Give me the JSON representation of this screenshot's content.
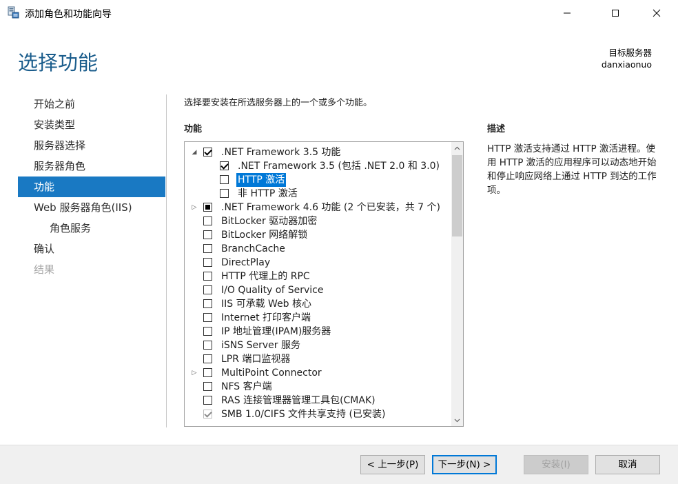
{
  "window": {
    "title": "添加角色和功能向导"
  },
  "header": {
    "page_title": "选择功能",
    "target_server_label": "目标服务器",
    "target_server_name": "danxiaonuo"
  },
  "nav": {
    "items": [
      {
        "label": "开始之前",
        "state": "normal"
      },
      {
        "label": "安装类型",
        "state": "normal"
      },
      {
        "label": "服务器选择",
        "state": "normal"
      },
      {
        "label": "服务器角色",
        "state": "normal"
      },
      {
        "label": "功能",
        "state": "active"
      },
      {
        "label": "Web 服务器角色(IIS)",
        "state": "normal"
      },
      {
        "label": "角色服务",
        "state": "sub"
      },
      {
        "label": "确认",
        "state": "normal"
      },
      {
        "label": "结果",
        "state": "disabled"
      }
    ]
  },
  "main": {
    "intro": "选择要安装在所选服务器上的一个或多个功能。",
    "features_header": "功能",
    "description_header": "描述",
    "description_text": "HTTP 激活支持通过 HTTP 激活进程。使用 HTTP 激活的应用程序可以动态地开始和停止响应网络上通过 HTTP 到达的工作项。"
  },
  "features": [
    {
      "label": ".NET Framework 3.5 功能",
      "level": 0,
      "expander": "expanded",
      "check": "checked"
    },
    {
      "label": ".NET Framework 3.5 (包括 .NET 2.0 和 3.0)",
      "level": 1,
      "expander": "none",
      "check": "checked"
    },
    {
      "label": "HTTP 激活",
      "level": 1,
      "expander": "none",
      "check": "unchecked",
      "selected": true
    },
    {
      "label": "非 HTTP 激活",
      "level": 1,
      "expander": "none",
      "check": "unchecked"
    },
    {
      "label": ".NET Framework 4.6 功能 (2 个已安装，共 7 个)",
      "level": 0,
      "expander": "collapsed",
      "check": "partial"
    },
    {
      "label": "BitLocker 驱动器加密",
      "level": 0,
      "expander": "none",
      "check": "unchecked"
    },
    {
      "label": "BitLocker 网络解锁",
      "level": 0,
      "expander": "none",
      "check": "unchecked"
    },
    {
      "label": "BranchCache",
      "level": 0,
      "expander": "none",
      "check": "unchecked"
    },
    {
      "label": "DirectPlay",
      "level": 0,
      "expander": "none",
      "check": "unchecked"
    },
    {
      "label": "HTTP 代理上的 RPC",
      "level": 0,
      "expander": "none",
      "check": "unchecked"
    },
    {
      "label": "I/O Quality of Service",
      "level": 0,
      "expander": "none",
      "check": "unchecked"
    },
    {
      "label": "IIS 可承载 Web 核心",
      "level": 0,
      "expander": "none",
      "check": "unchecked"
    },
    {
      "label": "Internet 打印客户端",
      "level": 0,
      "expander": "none",
      "check": "unchecked"
    },
    {
      "label": "IP 地址管理(IPAM)服务器",
      "level": 0,
      "expander": "none",
      "check": "unchecked"
    },
    {
      "label": "iSNS Server 服务",
      "level": 0,
      "expander": "none",
      "check": "unchecked"
    },
    {
      "label": "LPR 端口监视器",
      "level": 0,
      "expander": "none",
      "check": "unchecked"
    },
    {
      "label": "MultiPoint Connector",
      "level": 0,
      "expander": "collapsed",
      "check": "unchecked"
    },
    {
      "label": "NFS 客户端",
      "level": 0,
      "expander": "none",
      "check": "unchecked"
    },
    {
      "label": "RAS 连接管理器管理工具包(CMAK)",
      "level": 0,
      "expander": "none",
      "check": "unchecked"
    },
    {
      "label": "SMB 1.0/CIFS 文件共享支持 (已安装)",
      "level": 0,
      "expander": "none",
      "check": "disabled-checked"
    }
  ],
  "buttons": {
    "prev": "< 上一步(P)",
    "next": "下一步(N) >",
    "install": "安装(I)",
    "cancel": "取消"
  },
  "colors": {
    "accent": "#1979c3",
    "title": "#1b5d8c",
    "selection": "#0078d7"
  }
}
